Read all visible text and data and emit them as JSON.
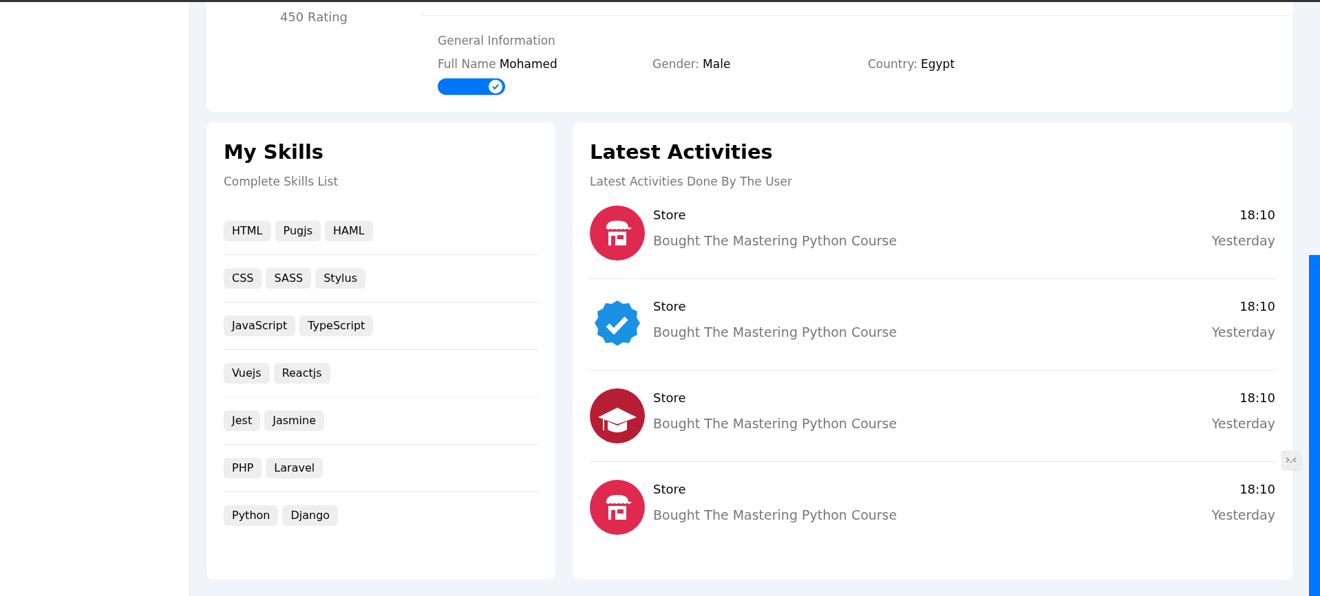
{
  "profile": {
    "rating": "450 Rating",
    "section_title": "General Information",
    "fields": [
      {
        "label": "Full Name",
        "value": "Mohamed"
      },
      {
        "label": "Gender:",
        "value": "Male"
      },
      {
        "label": "Country:",
        "value": "Egypt"
      }
    ],
    "toggle": {
      "on": true
    }
  },
  "skills": {
    "title": "My Skills",
    "subtitle": "Complete Skills List",
    "rows": [
      [
        "HTML",
        "Pugjs",
        "HAML"
      ],
      [
        "CSS",
        "SASS",
        "Stylus"
      ],
      [
        "JavaScript",
        "TypeScript"
      ],
      [
        "Vuejs",
        "Reactjs"
      ],
      [
        "Jest",
        "Jasmine"
      ],
      [
        "PHP",
        "Laravel"
      ],
      [
        "Python",
        "Django"
      ]
    ]
  },
  "activities": {
    "title": "Latest Activities",
    "subtitle": "Latest Activities Done By The User",
    "items": [
      {
        "kind": "store",
        "title": "Store",
        "description": "Bought The Mastering Python Course",
        "time": "18:10",
        "day": "Yesterday"
      },
      {
        "kind": "verified",
        "title": "Store",
        "description": "Bought The Mastering Python Course",
        "time": "18:10",
        "day": "Yesterday"
      },
      {
        "kind": "graduation",
        "title": "Store",
        "description": "Bought The Mastering Python Course",
        "time": "18:10",
        "day": "Yesterday"
      },
      {
        "kind": "store",
        "title": "Store",
        "description": "Bought The Mastering Python Course",
        "time": "18:10",
        "day": "Yesterday"
      }
    ]
  }
}
